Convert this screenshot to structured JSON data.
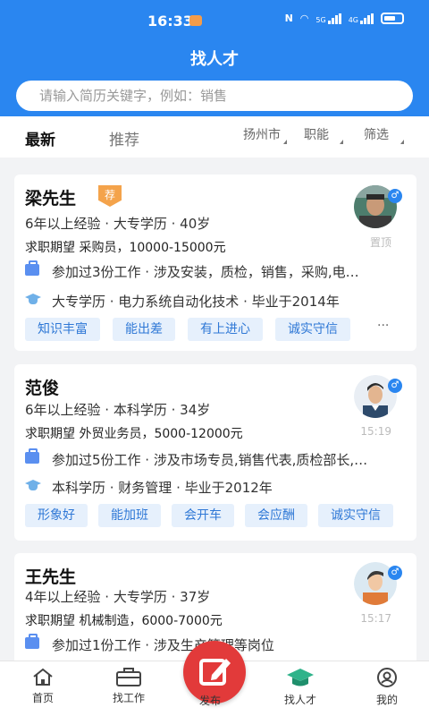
{
  "status": {
    "time": "16:33",
    "network": "5G",
    "network2": "4G"
  },
  "header": {
    "title": "找人才",
    "search_placeholder": "请输入简历关键字，例如：销售"
  },
  "tabs": {
    "latest": "最新",
    "recommend": "推荐"
  },
  "filters": {
    "city": "扬州市",
    "function": "职能",
    "screen": "筛选"
  },
  "cards": [
    {
      "name": "梁先生",
      "badge": "荐",
      "summary": "6年以上经验 · 大专学历 · 40岁",
      "expect": "求职期望 采购员，10000-15000元",
      "work": "参加过3份工作 · 涉及安装，质检，销售，采购,电…",
      "edu": "大专学历 · 电力系统自动化技术 · 毕业于2014年",
      "tags": [
        "知识丰富",
        "能出差",
        "有上进心",
        "诚实守信"
      ],
      "more": "···",
      "meta": "置顶",
      "gender": "♂"
    },
    {
      "name": "范俊",
      "summary": "6年以上经验 · 本科学历 · 34岁",
      "expect": "求职期望 外贸业务员，5000-12000元",
      "work": "参加过5份工作 · 涉及市场专员,销售代表,质检部长,…",
      "edu": "本科学历 · 财务管理 · 毕业于2012年",
      "tags": [
        "形象好",
        "能加班",
        "会开车",
        "会应酬",
        "诚实守信"
      ],
      "meta": "15:19",
      "gender": "♂"
    },
    {
      "name": "王先生",
      "summary": "4年以上经验 · 大专学历 · 37岁",
      "expect": "求职期望 机械制造，6000-7000元",
      "work": "参加过1份工作 · 涉及生产管理等岗位",
      "meta": "15:17",
      "gender": "♂"
    }
  ],
  "bottom_nav": {
    "home": "首页",
    "jobs": "找工作",
    "publish": "发布",
    "talent": "找人才",
    "mine": "我的"
  },
  "colors": {
    "primary": "#2a86f0",
    "accent": "#e23a3a",
    "badge": "#f4a34b",
    "tag_bg": "#e6f0fc"
  }
}
